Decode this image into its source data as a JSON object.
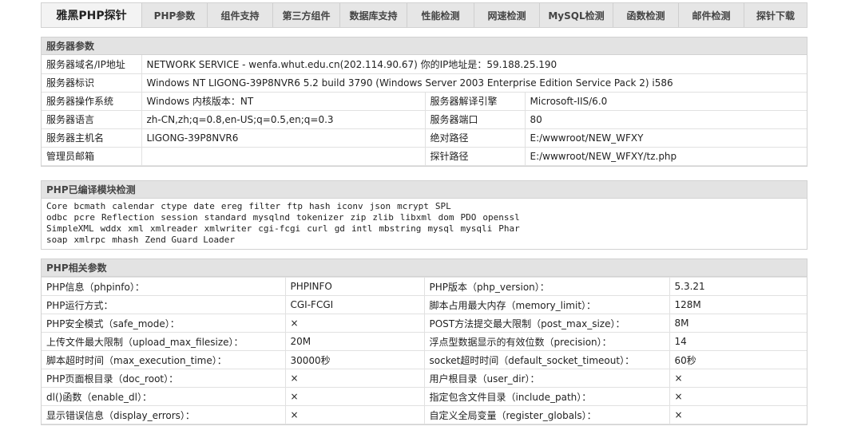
{
  "nav": {
    "brand": "雅黑PHP探针",
    "items": [
      "PHP参数",
      "组件支持",
      "第三方组件",
      "数据库支持",
      "性能检测",
      "网速检测",
      "MySQL检测",
      "函数检测",
      "邮件检测",
      "探针下载"
    ]
  },
  "server": {
    "title": "服务器参数",
    "rows": [
      {
        "label": "服务器域名/IP地址",
        "value": "NETWORK SERVICE - wenfa.whut.edu.cn(202.114.90.67)  你的IP地址是：59.188.25.190"
      },
      {
        "label": "服务器标识",
        "value": "Windows NT LIGONG-39P8NVR6 5.2 build 3790 (Windows Server 2003 Enterprise Edition Service Pack 2) i586"
      },
      {
        "label": "服务器操作系统",
        "value": "Windows  内核版本：NT",
        "label2": "服务器解译引擎",
        "value2": "Microsoft-IIS/6.0"
      },
      {
        "label": "服务器语言",
        "value": "zh-CN,zh;q=0.8,en-US;q=0.5,en;q=0.3",
        "label2": "服务器端口",
        "value2": "80"
      },
      {
        "label": "服务器主机名",
        "value": "LIGONG-39P8NVR6",
        "label2": "绝对路径",
        "value2": "E:/wwwroot/NEW_WFXY"
      },
      {
        "label": "管理员邮箱",
        "value": "",
        "label2": "探针路径",
        "value2": "E:/wwwroot/NEW_WFXY/tz.php"
      }
    ]
  },
  "modules": {
    "title": "PHP已编译模块检测",
    "lines": [
      [
        "Core",
        "bcmath",
        "calendar",
        "ctype",
        "date",
        "ereg",
        "filter",
        "ftp",
        "hash",
        "iconv",
        "json",
        "mcrypt",
        "SPL"
      ],
      [
        "odbc",
        "pcre",
        "Reflection",
        "session",
        "standard",
        "mysqlnd",
        "tokenizer",
        "zip",
        "zlib",
        "libxml",
        "dom",
        "PDO",
        "openssl"
      ],
      [
        "SimpleXML",
        "wddx",
        "xml",
        "xmlreader",
        "xmlwriter",
        "cgi-fcgi",
        "curl",
        "gd",
        "intl",
        "mbstring",
        "mysql",
        "mysqli",
        "Phar"
      ],
      [
        "soap",
        "xmlrpc",
        "mhash",
        "Zend Guard Loader"
      ]
    ]
  },
  "php": {
    "title": "PHP相关参数",
    "rows": [
      {
        "l1": "PHP信息（phpinfo）：",
        "v1": "PHPINFO",
        "v1_style": "grey",
        "l2": "PHP版本（php_version）：",
        "v2": "5.3.21",
        "v2_style": ""
      },
      {
        "l1": "PHP运行方式：",
        "v1": "CGI-FCGI",
        "v1_style": "",
        "l2": "脚本占用最大内存（memory_limit）：",
        "v2": "128M",
        "v2_style": ""
      },
      {
        "l1": "PHP安全模式（safe_mode）：",
        "v1": "×",
        "v1_style": "cross",
        "l2": "POST方法提交最大限制（post_max_size）：",
        "v2": "8M",
        "v2_style": ""
      },
      {
        "l1": "上传文件最大限制（upload_max_filesize）：",
        "v1": "20M",
        "v1_style": "",
        "l2": "浮点型数据显示的有效位数（precision）：",
        "v2": "14",
        "v2_style": ""
      },
      {
        "l1": "脚本超时时间（max_execution_time）：",
        "v1": "30000秒",
        "v1_style": "",
        "l2": "socket超时时间（default_socket_timeout）：",
        "v2": "60秒",
        "v2_style": ""
      },
      {
        "l1": "PHP页面根目录（doc_root）：",
        "v1": "×",
        "v1_style": "cross",
        "l2": "用户根目录（user_dir）：",
        "v2": "×",
        "v2_style": "cross"
      },
      {
        "l1": "dl()函数（enable_dl）：",
        "v1": "×",
        "v1_style": "cross",
        "l2": "指定包含文件目录（include_path）：",
        "v2": "×",
        "v2_style": "cross"
      },
      {
        "l1": "显示错误信息（display_errors）：",
        "v1": "×",
        "v1_style": "cross",
        "l2": "自定义全局变量（register_globals）：",
        "v2": "×",
        "v2_style": "cross"
      }
    ]
  },
  "colors": {
    "cross": "#e0362c",
    "header_bg": "#e3e3e3",
    "nav_bg": "#e6e6e6"
  }
}
